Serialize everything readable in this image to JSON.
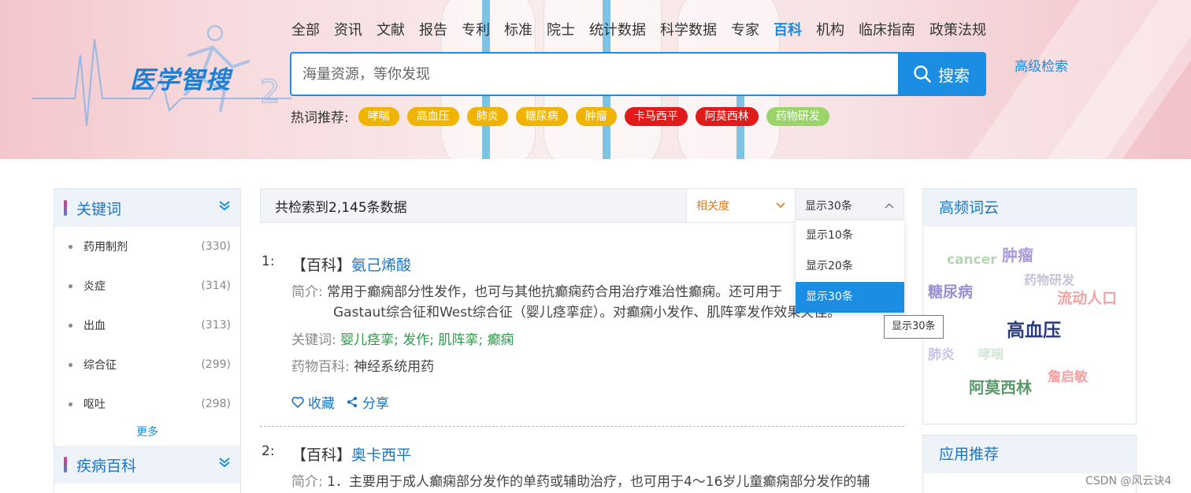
{
  "header": {
    "logo": "医学智搜",
    "nav": [
      "全部",
      "资讯",
      "文献",
      "报告",
      "专利",
      "标准",
      "院士",
      "统计数据",
      "科学数据",
      "专家",
      "百科",
      "机构",
      "临床指南",
      "政策法规"
    ],
    "nav_active": "百科",
    "search_placeholder": "海量资源，等你发现",
    "search_button": "搜索",
    "advanced": "高级检索",
    "hot_label": "热词推荐:",
    "hot_tags": [
      {
        "label": "哮喘",
        "color": "#f0b400"
      },
      {
        "label": "高血压",
        "color": "#f0b400"
      },
      {
        "label": "肺炎",
        "color": "#f0b400"
      },
      {
        "label": "糖尿病",
        "color": "#f0b400"
      },
      {
        "label": "肿瘤",
        "color": "#f0b400"
      },
      {
        "label": "卡马西平",
        "color": "#e01b1b"
      },
      {
        "label": "阿莫西林",
        "color": "#e01b1b"
      },
      {
        "label": "药物研发",
        "color": "#9bd46a"
      }
    ]
  },
  "sidebar": {
    "keywords_title": "关键词",
    "keywords": [
      {
        "name": "药用制剂",
        "count": "(330)"
      },
      {
        "name": "炎症",
        "count": "(314)"
      },
      {
        "name": "出血",
        "count": "(313)"
      },
      {
        "name": "综合征",
        "count": "(299)"
      },
      {
        "name": "呕吐",
        "count": "(298)"
      }
    ],
    "more": "更多",
    "disease_title": "疾病百科"
  },
  "results_bar": {
    "count_text": "共检索到2,145条数据",
    "sort_label": "相关度",
    "show_label": "显示30条",
    "dropdown": [
      "显示10条",
      "显示20条",
      "显示30条"
    ],
    "dropdown_selected": "显示30条",
    "tooltip": "显示30条"
  },
  "results": [
    {
      "num": "1:",
      "prefix": "【百科】",
      "title": "氨己烯酸",
      "summary_label": "简介:",
      "summary_line1": "常用于癫痫部分性发作，也可与其他抗癫痫药合用治疗难治性癫痫。还可用于",
      "summary_line2": "Gastaut综合征和West综合征（婴儿痉挛症）。对癫痫小发作、肌阵挛发作效果欠佳。",
      "keywords_label": "关键词:",
      "keywords": [
        "婴儿痉挛",
        "发作",
        "肌阵挛",
        "癫痫"
      ],
      "drug_label": "药物百科:",
      "drug_value": "神经系统用药",
      "fav": "收藏",
      "share": "分享"
    },
    {
      "num": "2:",
      "prefix": "【百科】",
      "title": "奥卡西平",
      "summary_label": "简介:",
      "summary_line1": "1．主要用于成人癫痫部分发作的单药或辅助治疗，也可用于4～16岁儿童癫痫部分发作的辅"
    }
  ],
  "right": {
    "cloud_title": "高频词云",
    "cloud": [
      {
        "w": "cancer",
        "color": "#b5d6b0"
      },
      {
        "w": "肿瘤",
        "color": "#a99ad6"
      },
      {
        "w": "药物研发",
        "color": "#c5c5d8"
      },
      {
        "w": "糖尿病",
        "color": "#9b8fd0"
      },
      {
        "w": "流动人口",
        "color": "#f2a3a3"
      },
      {
        "w": "高血压",
        "color": "#2a3a7a"
      },
      {
        "w": "肺炎",
        "color": "#c8c3e8"
      },
      {
        "w": "哮喘",
        "color": "#d5e5d5"
      },
      {
        "w": "阿莫西林",
        "color": "#5a9a6a"
      },
      {
        "w": "詹启敏",
        "color": "#f2a3a3"
      }
    ],
    "apps_title": "应用推荐"
  },
  "watermark": "CSDN @风云诀4",
  "colors": {
    "accent": "#1b8ee3",
    "link": "#1a75c7",
    "keyword_green": "#2e9a4a",
    "sort_orange": "#e07b1f"
  }
}
